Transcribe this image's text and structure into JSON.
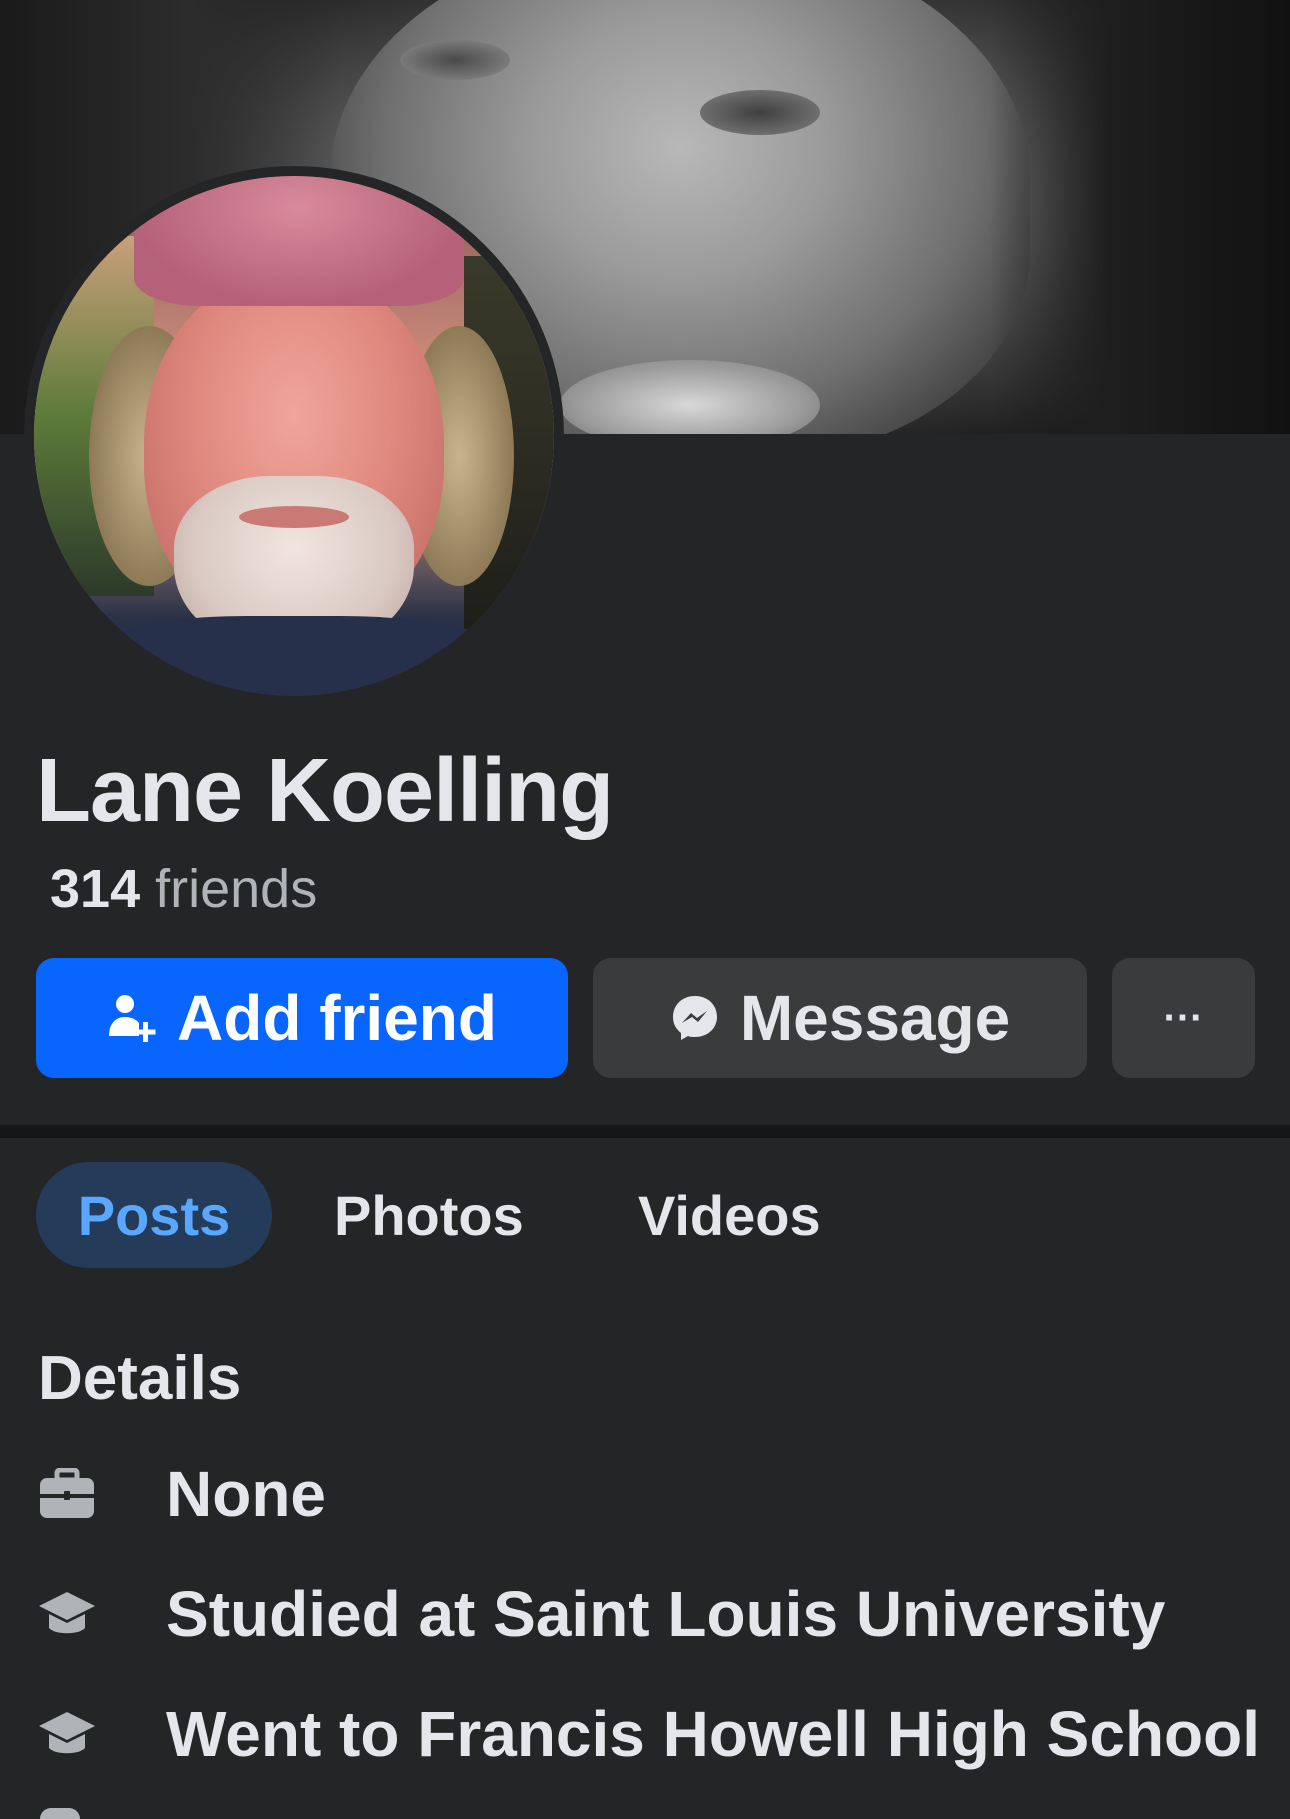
{
  "profile": {
    "name": "Lane Koelling",
    "friends_count": "314",
    "friends_label": "friends"
  },
  "actions": {
    "add_friend": "Add friend",
    "message": "Message",
    "more": "···"
  },
  "tabs": [
    {
      "label": "Posts",
      "active": true
    },
    {
      "label": "Photos",
      "active": false
    },
    {
      "label": "Videos",
      "active": false
    }
  ],
  "details": {
    "title": "Details",
    "items": [
      {
        "icon": "briefcase-icon",
        "text": "None"
      },
      {
        "icon": "graduation-cap-icon",
        "text": "Studied at Saint Louis University"
      },
      {
        "icon": "graduation-cap-icon",
        "text": "Went to Francis Howell High School"
      }
    ]
  },
  "colors": {
    "background": "#242527",
    "primary_button": "#0866ff",
    "secondary_button": "#3a3b3d",
    "active_tab_bg": "#243c5a",
    "active_tab_text": "#5aa7ff",
    "text": "#e4e6eb",
    "muted_text": "#b0b3b8"
  }
}
